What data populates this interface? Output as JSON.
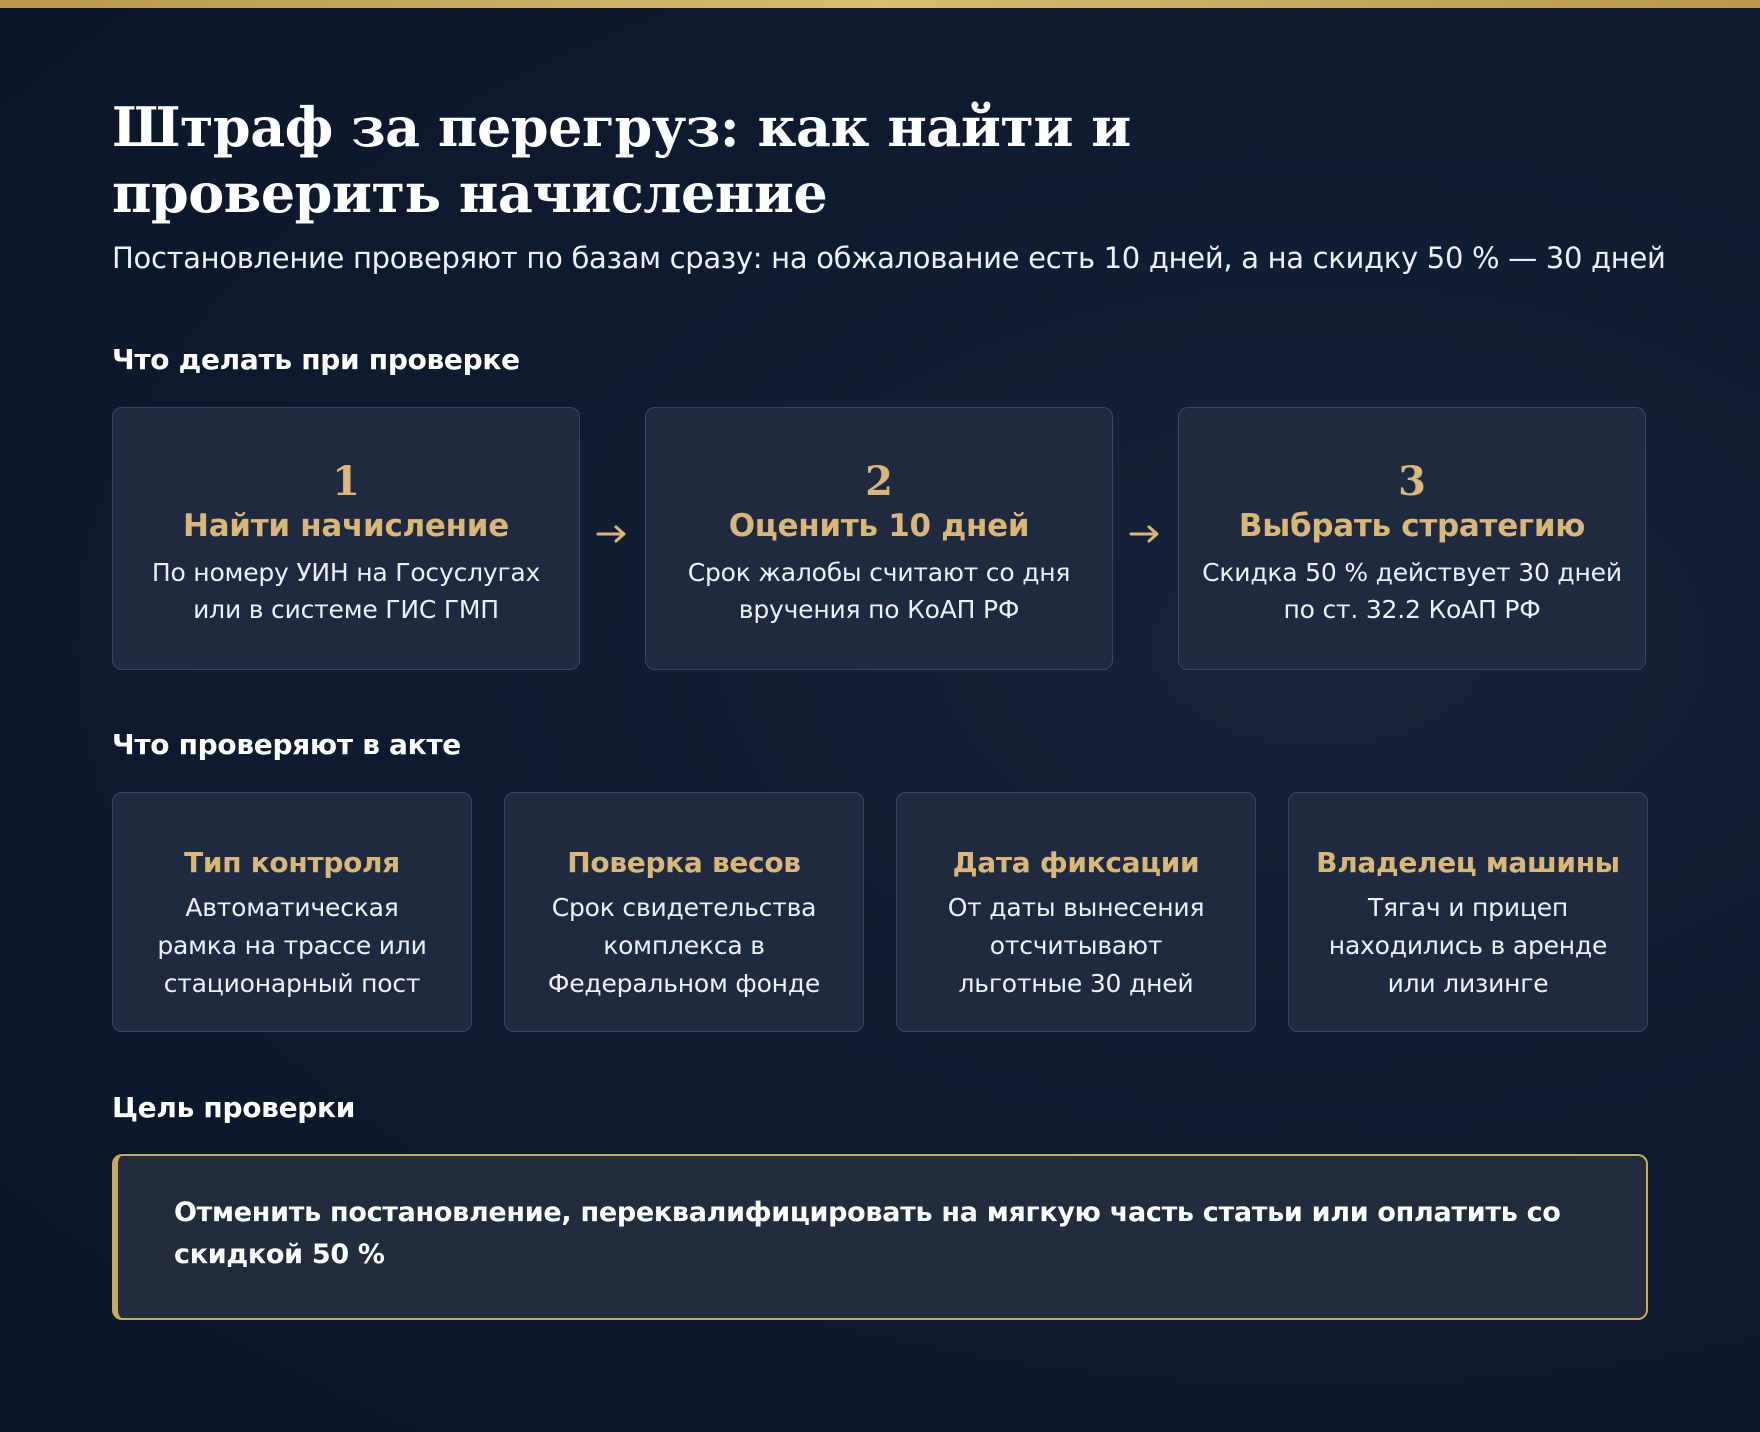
{
  "header": {
    "title": "Штраф за перегруз: как найти и проверить начисление",
    "subtitle": "Постановление проверяют по базам сразу: на обжалование есть 10 дней, а на скидку 50 % — 30 дней"
  },
  "steps_section": {
    "title": "Что делать при проверке",
    "steps": [
      {
        "number": "1",
        "title": "Найти начисление",
        "description": "По номеру УИН на Госуслугах или в системе ГИС ГМП"
      },
      {
        "number": "2",
        "title": "Оценить 10 дней",
        "description": "Срок жалобы считают со дня вручения по КоАП РФ"
      },
      {
        "number": "3",
        "title": "Выбрать стратегию",
        "description": "Скидка 50 % действует 30 дней по ст. 32.2 КоАП РФ"
      }
    ]
  },
  "checks_section": {
    "title": "Что проверяют в акте",
    "items": [
      {
        "title": "Тип контроля",
        "description": "Автоматическая рамка на трассе или стационарный пост"
      },
      {
        "title": "Поверка весов",
        "description": "Срок свидетельства комплекса в Федеральном фонде"
      },
      {
        "title": "Дата фиксации",
        "description": "От даты вынесения отсчитывают льготные 30 дней"
      },
      {
        "title": "Владелец машины",
        "description": "Тягач и прицеп находились в аренде или лизинге"
      }
    ]
  },
  "goal_section": {
    "title": "Цель проверки",
    "text": "Отменить постановление, переквалифицировать на мягкую часть статьи или оплатить со скидкой 50 %"
  },
  "colors": {
    "background": "#0f1b31",
    "accent_gold": "#d9b776",
    "card_background": "#1f2a41",
    "card_border": "#3a4661"
  }
}
